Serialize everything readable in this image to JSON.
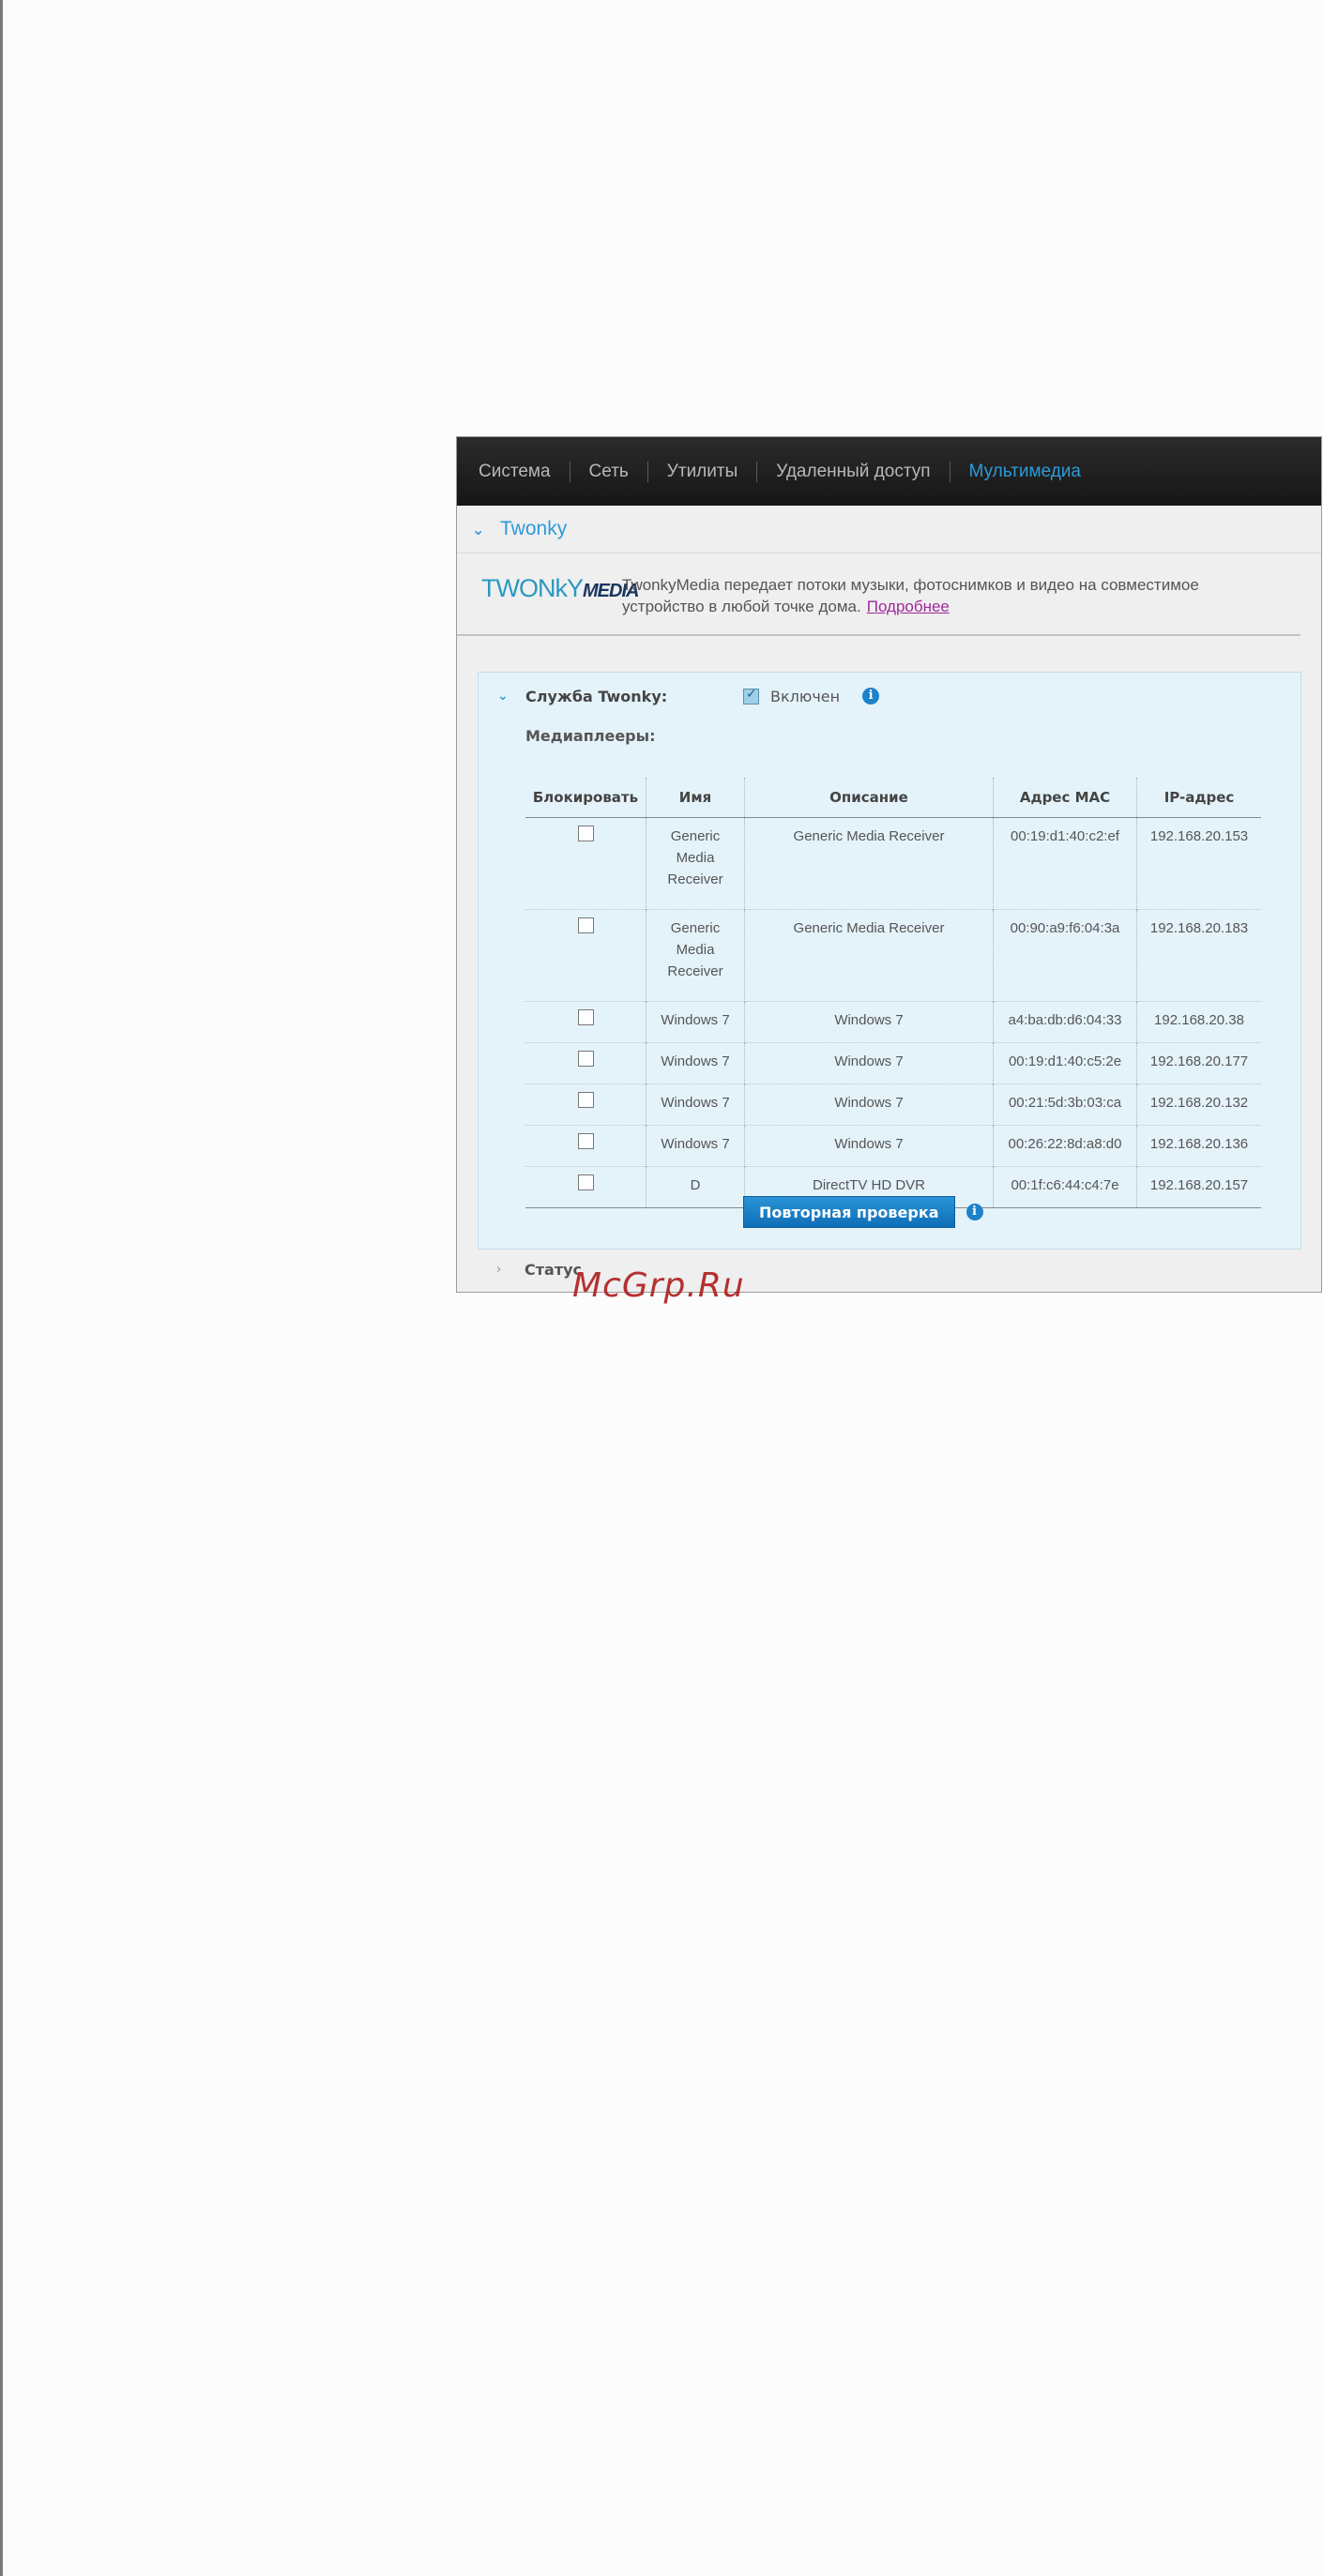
{
  "nav": {
    "items": [
      {
        "label": "Система",
        "active": false
      },
      {
        "label": "Сеть",
        "active": false
      },
      {
        "label": "Утилиты",
        "active": false
      },
      {
        "label": "Удаленный доступ",
        "active": false
      },
      {
        "label": "Мультимедиа",
        "active": true
      }
    ]
  },
  "section": {
    "title": "Twonky"
  },
  "intro": {
    "logo_text_a": "TWONkY",
    "logo_text_b": "MEDIA",
    "text": "TwonkyMedia передает потоки музыки, фотоснимков и видео на совместимое устройство в любой точке дома.",
    "link": "Подробнее"
  },
  "service": {
    "label": "Служба Twonky:",
    "enabled": true,
    "state_label": "Включен"
  },
  "players": {
    "label": "Медиаплееры:",
    "columns": [
      "Блокировать",
      "Имя",
      "Описание",
      "Адрес MAC",
      "IP-адрес"
    ],
    "rows": [
      {
        "blocked": false,
        "name": "Generic Media Receiver",
        "description": "Generic Media Receiver",
        "mac": "00:19:d1:40:c2:ef",
        "ip": "192.168.20.153"
      },
      {
        "blocked": false,
        "name": "Generic Media Receiver",
        "description": "Generic Media Receiver",
        "mac": "00:90:a9:f6:04:3a",
        "ip": "192.168.20.183"
      },
      {
        "blocked": false,
        "name": "Windows 7",
        "description": "Windows 7",
        "mac": "a4:ba:db:d6:04:33",
        "ip": "192.168.20.38"
      },
      {
        "blocked": false,
        "name": "Windows 7",
        "description": "Windows 7",
        "mac": "00:19:d1:40:c5:2e",
        "ip": "192.168.20.177"
      },
      {
        "blocked": false,
        "name": "Windows 7",
        "description": "Windows 7",
        "mac": "00:21:5d:3b:03:ca",
        "ip": "192.168.20.132"
      },
      {
        "blocked": false,
        "name": "Windows 7",
        "description": "Windows 7",
        "mac": "00:26:22:8d:a8:d0",
        "ip": "192.168.20.136"
      },
      {
        "blocked": false,
        "name": "D",
        "description": "DirectTV HD DVR",
        "mac": "00:1f:c6:44:c4:7e",
        "ip": "192.168.20.157"
      }
    ]
  },
  "rescan_label": "Повторная проверка",
  "status_label": "Статус",
  "watermark": "McGrp.Ru",
  "colors": {
    "accent": "#2d9bd8",
    "panel": "#e4f3fa",
    "link": "#a0299a"
  }
}
